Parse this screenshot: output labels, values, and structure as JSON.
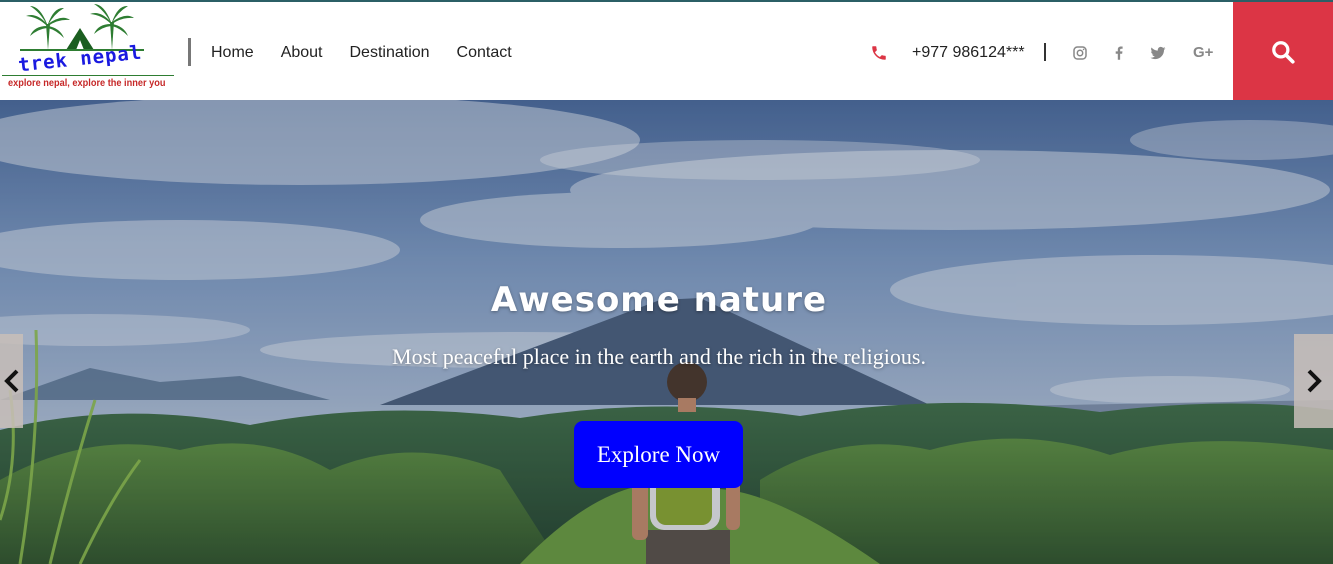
{
  "brand": {
    "name": "trek nepal",
    "tagline": "explore nepal, explore the inner you"
  },
  "nav": {
    "items": [
      {
        "label": "Home"
      },
      {
        "label": "About"
      },
      {
        "label": "Destination"
      },
      {
        "label": "Contact"
      }
    ]
  },
  "contact": {
    "phone": "+977 986124***",
    "divider": "|"
  },
  "social": {
    "icons": [
      "instagram-icon",
      "facebook-icon",
      "twitter-icon",
      "google-plus-icon"
    ],
    "gplus_label": "G+"
  },
  "colors": {
    "accent_red": "#dc3545",
    "cta_blue": "#0000ff",
    "brand_blue": "#1a1ae0",
    "tagline_red": "#c62828"
  },
  "hero": {
    "title": "Awesome nature",
    "subtitle": "Most peaceful place in the earth and the rich in the religious.",
    "cta_label": "Explore Now"
  }
}
